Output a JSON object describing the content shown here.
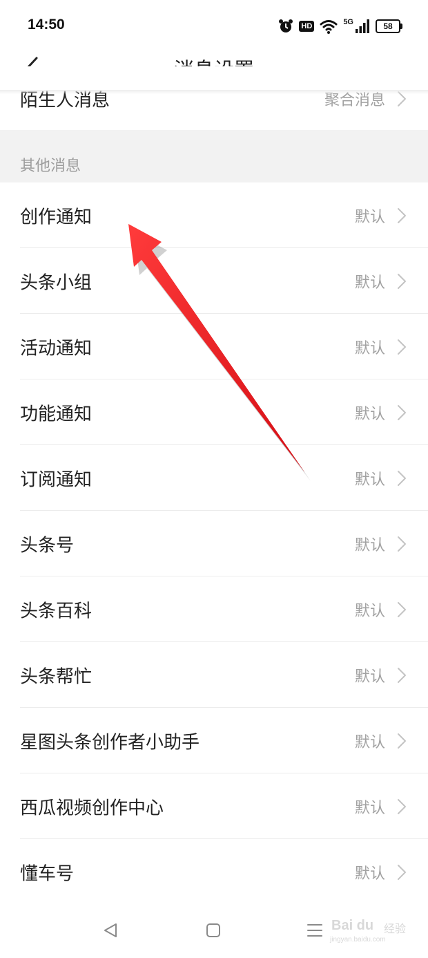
{
  "status_bar": {
    "time": "14:50",
    "hd_label": "HD",
    "network_label": "5G",
    "battery_level": "58",
    "icons": [
      "alarm-icon",
      "hd-icon",
      "wifi-icon",
      "signal-icon",
      "battery-icon"
    ]
  },
  "header": {
    "title": "消息设置",
    "back_icon": "chevron-left-icon"
  },
  "top_row": {
    "label": "陌生人消息",
    "value": "聚合消息"
  },
  "section": {
    "title": "其他消息"
  },
  "items": [
    {
      "label": "创作通知",
      "value": "默认"
    },
    {
      "label": "头条小组",
      "value": "默认"
    },
    {
      "label": "活动通知",
      "value": "默认"
    },
    {
      "label": "功能通知",
      "value": "默认"
    },
    {
      "label": "订阅通知",
      "value": "默认"
    },
    {
      "label": "头条号",
      "value": "默认"
    },
    {
      "label": "头条百科",
      "value": "默认"
    },
    {
      "label": "头条帮忙",
      "value": "默认"
    },
    {
      "label": "星图头条创作者小助手",
      "value": "默认"
    },
    {
      "label": "西瓜视频创作中心",
      "value": "默认"
    },
    {
      "label": "懂车号",
      "value": "默认"
    }
  ],
  "bottom_nav": {
    "icons": [
      "back-triangle-icon",
      "home-square-icon",
      "menu-lines-icon"
    ]
  },
  "watermark": {
    "brand": "Bai du",
    "suffix": "经验",
    "url": "jingyan.baidu.com"
  },
  "colors": {
    "annotation_arrow": "#e8141c",
    "section_bg": "#f2f2f2",
    "secondary_text": "#a2a2a2"
  }
}
